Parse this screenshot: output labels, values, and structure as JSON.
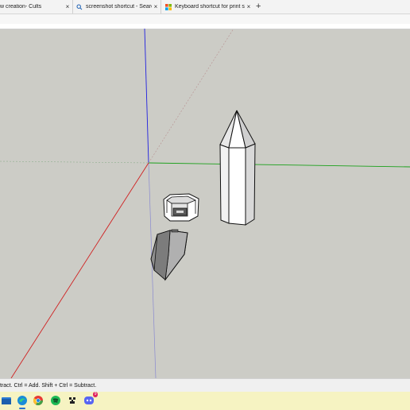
{
  "tabs": [
    {
      "label": "w creation- Cults",
      "close": "×"
    },
    {
      "label": "screenshot shortcut - Search",
      "close": "×",
      "icon": "search-icon"
    },
    {
      "label": "Keyboard shortcut for print scree",
      "close": "×",
      "icon": "microsoft-logo-icon"
    }
  ],
  "new_tab": "+",
  "status_text": "tract. Ctrl = Add. Shift + Ctrl = Subtract.",
  "taskbar": {
    "items": [
      "file-explorer-icon",
      "edge-icon",
      "chrome-icon",
      "spotify-icon",
      "minecraft-icon",
      "discord-icon"
    ],
    "discord_badge": "9"
  },
  "colors": {
    "canvas": "#ccccc6",
    "axis_blue": "#2020e0",
    "axis_green": "#1aa01a",
    "axis_red": "#d02020",
    "taskbar": "#f6f3c2"
  }
}
